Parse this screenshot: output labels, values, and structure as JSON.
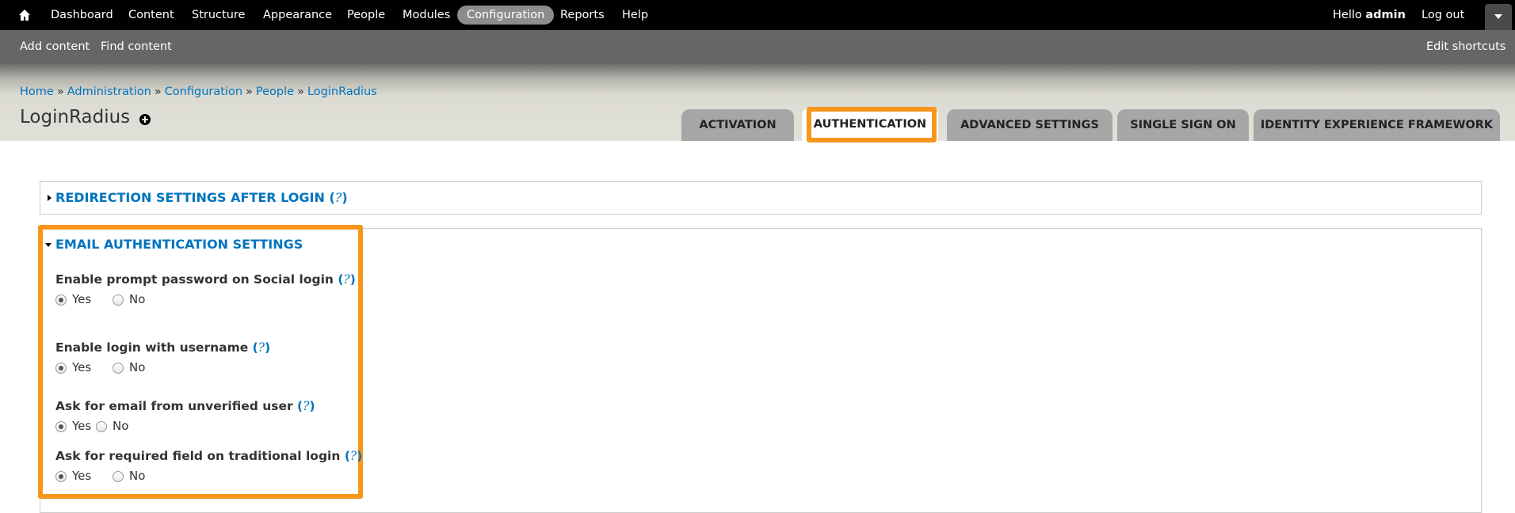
{
  "toolbar": {
    "items": [
      "Dashboard",
      "Content",
      "Structure",
      "Appearance",
      "People",
      "Modules",
      "Configuration",
      "Reports",
      "Help"
    ],
    "active": "Configuration",
    "hello_prefix": "Hello",
    "user": "admin",
    "logout": "Log out"
  },
  "shortcuts": {
    "add_content": "Add content",
    "find_content": "Find content",
    "edit_shortcuts": "Edit shortcuts"
  },
  "breadcrumb": [
    "Home",
    "Administration",
    "Configuration",
    "People",
    "LoginRadius"
  ],
  "breadcrumb_separator": "»",
  "page_title": "LoginRadius",
  "tabs": [
    "ACTIVATION",
    "AUTHENTICATION",
    "ADVANCED SETTINGS",
    "SINGLE SIGN ON",
    "IDENTITY EXPERIENCE FRAMEWORK"
  ],
  "active_tab": "AUTHENTICATION",
  "sections": {
    "redirection": {
      "title": "REDIRECTION SETTINGS AFTER LOGIN",
      "help": "?",
      "collapsed": true
    },
    "email_auth": {
      "title": "EMAIL AUTHENTICATION SETTINGS",
      "collapsed": false,
      "fields": [
        {
          "label": "Enable prompt password on Social login",
          "help": "?",
          "options": [
            "Yes",
            "No"
          ],
          "selected": "Yes"
        },
        {
          "label": "Enable login with username",
          "help": "?",
          "options": [
            "Yes",
            "No"
          ],
          "selected": "Yes"
        },
        {
          "label": "Ask for email from unverified user",
          "help": "?",
          "options": [
            "Yes",
            "No"
          ],
          "selected": "Yes"
        },
        {
          "label": "Ask for required field on traditional login",
          "help": "?",
          "options": [
            "Yes",
            "No"
          ],
          "selected": "Yes"
        }
      ]
    }
  },
  "colors": {
    "toolbar_bg": "#000000",
    "shortcut_bg": "#666666",
    "link": "#0074bd",
    "highlight": "#f7961d",
    "tab_bg": "#a6a6a6"
  },
  "icons": [
    "home-icon",
    "add-shortcut-icon",
    "toolbar-toggle-icon",
    "collapsed-triangle-icon",
    "expanded-triangle-icon"
  ]
}
